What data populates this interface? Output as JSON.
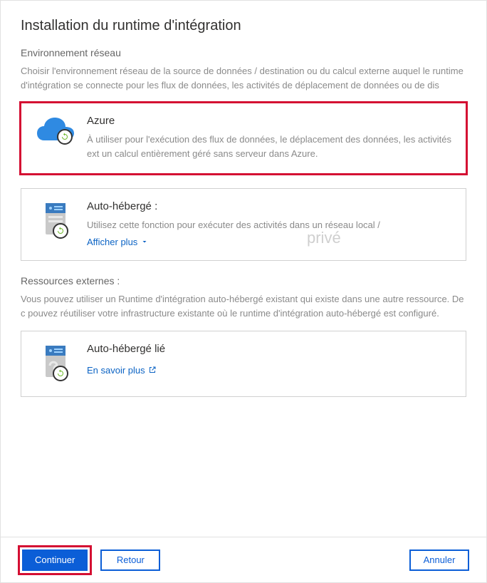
{
  "title": "Installation du runtime d'intégration",
  "env": {
    "label": "Environnement réseau",
    "desc": "Choisir l'environnement réseau de la source de données /  destination ou du calcul externe auquel le runtime d'intégration se connecte pour les flux de données, les activités de déplacement de données ou de dis"
  },
  "cards": {
    "azure": {
      "title": "Azure",
      "desc": "À utiliser pour l'exécution des flux de données, le déplacement des données, les activités ext un calcul entièrement géré sans serveur dans Azure."
    },
    "self": {
      "title": "Auto-hébergé :",
      "desc": "Utilisez cette fonction pour exécuter des activités dans un réseau local /",
      "more": "Afficher plus"
    },
    "linked": {
      "title": "Auto-hébergé lié",
      "more": "En savoir plus"
    }
  },
  "external": {
    "label": "Ressources externes :",
    "desc": "Vous pouvez utiliser un Runtime d'intégration auto-hébergé existant qui existe dans une autre ressource. De c pouvez réutiliser votre infrastructure existante où le runtime d'intégration auto-hébergé est configuré."
  },
  "watermark": "privé",
  "buttons": {
    "continue": "Continuer",
    "back": "Retour",
    "cancel": "Annuler"
  }
}
